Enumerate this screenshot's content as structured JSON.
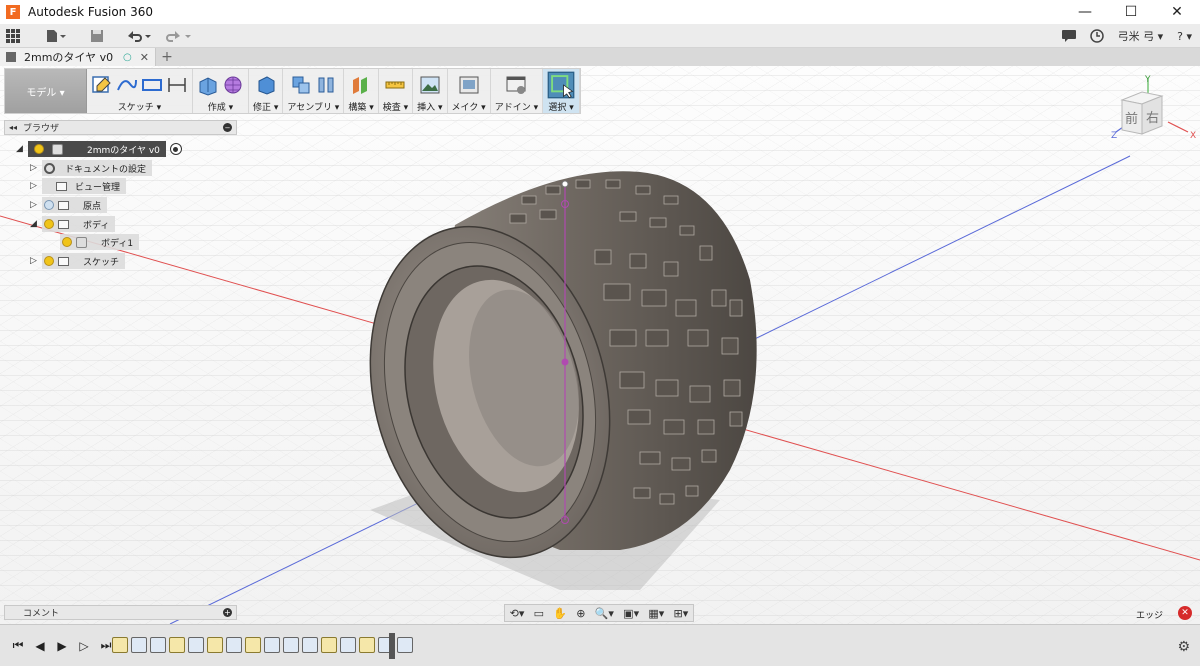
{
  "app": {
    "title": "Autodesk Fusion 360",
    "logo_letter": "F"
  },
  "window_controls": {
    "minimize": "—",
    "maximize": "☐",
    "close": "✕"
  },
  "quickbar": {
    "user_name": "弓米 弓 ▾",
    "help": "? ▾"
  },
  "document_tab": {
    "label": "2mmのタイヤ v0",
    "close": "✕",
    "new_tab": "+"
  },
  "toolbar": {
    "workspace": "モデル ▾",
    "groups": [
      {
        "label": "スケッチ ▾"
      },
      {
        "label": "作成 ▾"
      },
      {
        "label": "修正 ▾"
      },
      {
        "label": "アセンブリ ▾"
      },
      {
        "label": "構築 ▾"
      },
      {
        "label": "検査 ▾"
      },
      {
        "label": "挿入 ▾"
      },
      {
        "label": "メイク ▾"
      },
      {
        "label": "アドイン ▾"
      },
      {
        "label": "選択 ▾"
      }
    ]
  },
  "browser": {
    "title": "ブラウザ",
    "root": "2mmのタイヤ v0",
    "items": [
      {
        "label": "ドキュメントの設定"
      },
      {
        "label": "ビュー管理"
      },
      {
        "label": "原点"
      },
      {
        "label": "ボディ"
      },
      {
        "label": "ボディ1"
      },
      {
        "label": "スケッチ"
      }
    ]
  },
  "comments": {
    "title": "コメント"
  },
  "status": {
    "display_mode": "エッジ"
  },
  "viewcube": {
    "front": "前",
    "right": "右",
    "x": "X",
    "y": "Y",
    "z": "Z"
  },
  "colors": {
    "selection": "#4f8db8",
    "tire": "#7d766f",
    "axis_red": "#e05050",
    "axis_blue": "#5a6ad8"
  }
}
